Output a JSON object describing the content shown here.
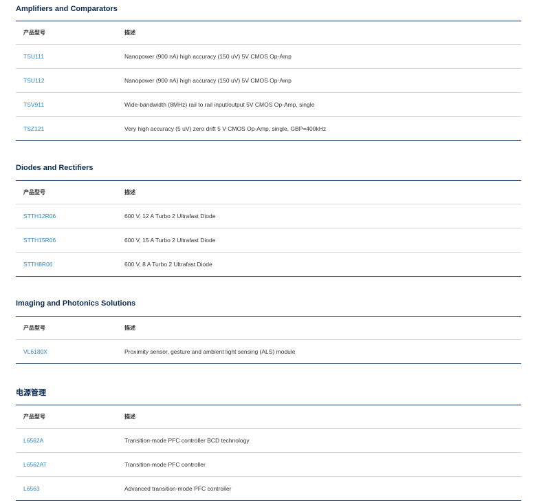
{
  "sections": [
    {
      "title": "Amplifiers and Comparators",
      "headers": [
        "产品型号",
        "描述"
      ],
      "rows": [
        [
          "TSU111",
          "Nanopower (900 nA) high accuracy (150 uV) 5V CMOS Op-Amp"
        ],
        [
          "TSU112",
          "Nanopower (900 nA) high accuracy (150 uV) 5V CMOS Op-Amp"
        ],
        [
          "TSV911",
          "Wide-bandwidth (8MHz) rail to rail input/output 5V CMOS Op-Amp, single"
        ],
        [
          "TSZ121",
          "Very high accuracy (5 uV) zero drift 5 V CMOS Op-Amp, single, GBP=400kHz"
        ]
      ]
    },
    {
      "title": "Diodes and Rectifiers",
      "headers": [
        "产品型号",
        "描述"
      ],
      "rows": [
        [
          "STTH12R06",
          "600 V, 12 A Turbo 2 Ultrafast Diode"
        ],
        [
          "STTH15R06",
          "600 V, 15 A Turbo 2 Ultrafast Diode"
        ],
        [
          "STTH8R06",
          "600 V, 8 A Turbo 2 Ultrafast Diode"
        ]
      ]
    },
    {
      "title": "Imaging and Photonics Solutions",
      "headers": [
        "产品型号",
        "描述"
      ],
      "rows": [
        [
          "VL6180X",
          "Proximity sensor, gesture and ambient light sensing (ALS) module"
        ]
      ]
    },
    {
      "title": "电源管理",
      "headers": [
        "产品型号",
        "描述"
      ],
      "rows": [
        [
          "L6562A",
          "Transition-mode PFC controller BCD technology"
        ],
        [
          "L6562AT",
          "Transition-mode PFC controller"
        ],
        [
          "L6563",
          "Advanced transition-mode PFC controller"
        ]
      ]
    }
  ]
}
